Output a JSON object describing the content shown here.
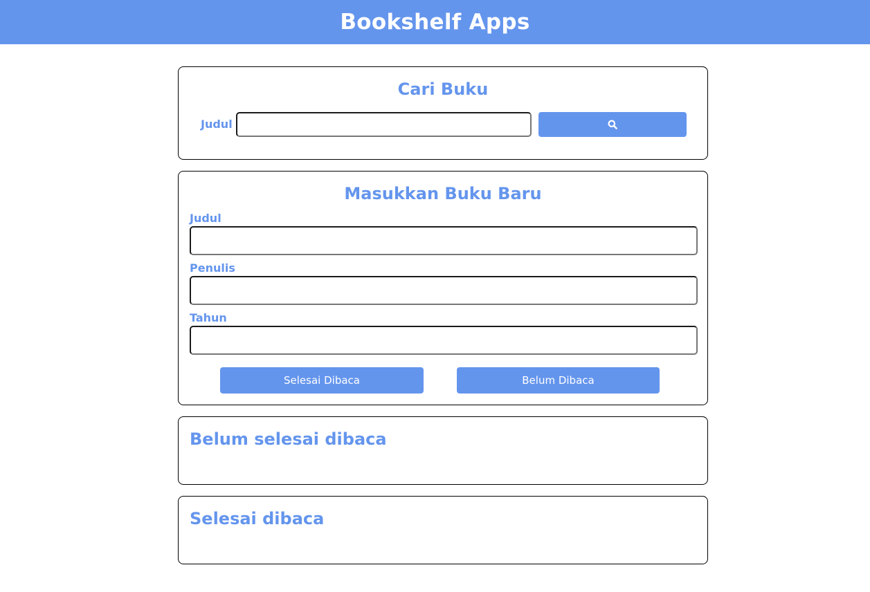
{
  "header": {
    "title": "Bookshelf Apps"
  },
  "search": {
    "heading": "Cari Buku",
    "label": "Judul",
    "value": "",
    "button_icon": "search-icon"
  },
  "input_book": {
    "heading": "Masukkan Buku Baru",
    "title_label": "Judul",
    "title_value": "",
    "author_label": "Penulis",
    "author_value": "",
    "year_label": "Tahun",
    "year_value": "",
    "complete_button": "Selesai Dibaca",
    "incomplete_button": "Belum Dibaca"
  },
  "shelves": {
    "incomplete_heading": "Belum selesai dibaca",
    "complete_heading": "Selesai dibaca"
  },
  "colors": {
    "accent": "#6495ed",
    "border": "#000000",
    "background": "#ffffff"
  }
}
